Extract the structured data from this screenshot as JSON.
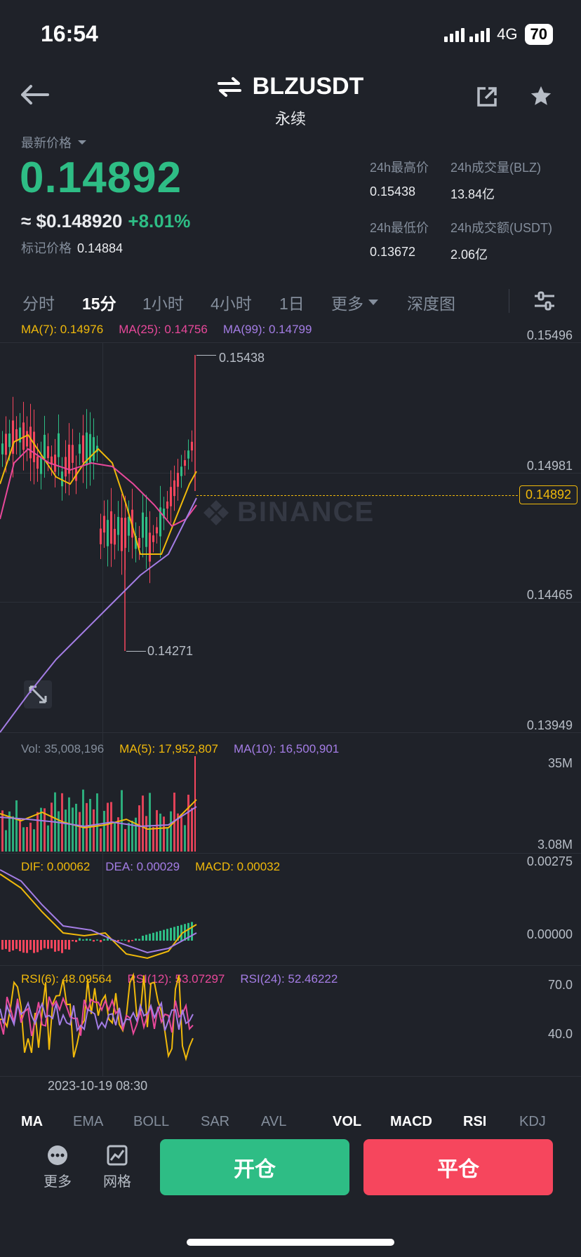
{
  "status": {
    "time": "16:54",
    "network": "4G",
    "battery": "70"
  },
  "nav": {
    "symbol": "BLZUSDT",
    "subtitle": "永续"
  },
  "price": {
    "type_label": "最新价格",
    "last": "0.14892",
    "usd": "≈ $0.148920",
    "change": "+8.01%",
    "mark_label": "标记价格",
    "mark_value": "0.14884"
  },
  "stats": {
    "high_label": "24h最高价",
    "high_value": "0.15438",
    "vol_blz_label": "24h成交量(BLZ)",
    "vol_blz_value": "13.84亿",
    "low_label": "24h最低价",
    "low_value": "0.13672",
    "vol_usdt_label": "24h成交额(USDT)",
    "vol_usdt_value": "2.06亿"
  },
  "tabs": [
    "分时",
    "15分",
    "1小时",
    "4小时",
    "1日",
    "更多",
    "深度图"
  ],
  "active_tab": "15分",
  "main_chart": {
    "ma7": "MA(7): 0.14976",
    "ma25": "MA(25): 0.14756",
    "ma99": "MA(99): 0.14799",
    "axis": [
      "0.15496",
      "0.14981",
      "0.14465",
      "0.13949"
    ],
    "current_price": "0.14892",
    "high_marker": "0.15438",
    "low_marker": "0.14271",
    "watermark": "BINANCE"
  },
  "volume": {
    "vol": "Vol: 35,008,196",
    "ma5": "MA(5): 17,952,807",
    "ma10": "MA(10): 16,500,901",
    "axis_top": "35M",
    "axis_bottom": "3.08M"
  },
  "macd": {
    "dif": "DIF: 0.00062",
    "dea": "DEA: 0.00029",
    "macd": "MACD: 0.00032",
    "axis_top": "0.00275",
    "axis_mid": "0.00000"
  },
  "rsi": {
    "rsi6": "RSI(6): 48.09564",
    "rsi12": "RSI(12): 53.07297",
    "rsi24": "RSI(24): 52.46222",
    "axis_top": "70.0",
    "axis_bottom": "40.0"
  },
  "time_label": "2023-10-19 08:30",
  "indicator_tabs": [
    "MA",
    "EMA",
    "BOLL",
    "SAR",
    "AVL",
    "VOL",
    "MACD",
    "RSI",
    "KDJ"
  ],
  "footer": {
    "more": "更多",
    "grid": "网格",
    "open": "开仓",
    "close": "平仓"
  },
  "colors": {
    "up": "#2ebd85",
    "down": "#f6465d",
    "ma7": "#f0b90b",
    "ma25": "#e8489a",
    "ma99": "#a47de5"
  }
}
